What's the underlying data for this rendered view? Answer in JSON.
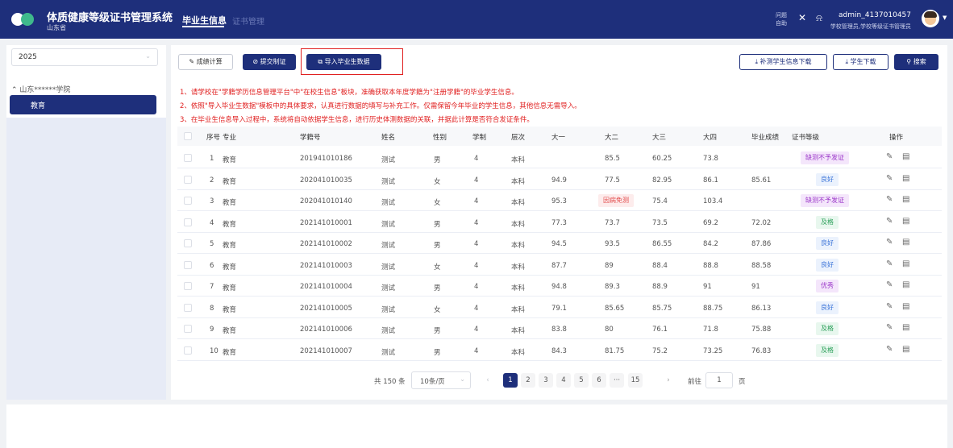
{
  "header": {
    "system_title": "体质健康等级证书管理系统",
    "province": "山东省",
    "nav_active": "毕业生信息",
    "nav_other": "证书管理",
    "help_label": "问题自助",
    "user_name": "admin_4137010457",
    "user_role": "学校管理员,学校等级证书管理员"
  },
  "sidebar": {
    "year": "2025",
    "tree_root": "山东******学院",
    "tree_node": "教育"
  },
  "toolbar": {
    "calc_label": "成绩计算",
    "submit_label": "提交制证",
    "import_label": "导入毕业生数据",
    "supplement_label": "补测学生信息下载",
    "student_download_label": "学生下载",
    "search_label": "搜索"
  },
  "notices": [
    "1、请学校在\"学籍学历信息管理平台\"中\"在校生信息\"板块，准确获取本年度学籍为\"注册学籍\"的毕业学生信息。",
    "2、依照\"导入毕业生数据\"模板中的具体要求，认真进行数据的填写与补充工作。仅需保留今年毕业的学生信息，其他信息无需导入。",
    "3、在毕业生信息导入过程中，系统将自动依据学生信息，进行历史体测数据的关联，并据此计算是否符合发证条件。"
  ],
  "table": {
    "columns": [
      "序号",
      "专业",
      "学籍号",
      "姓名",
      "性别",
      "学制",
      "层次",
      "大一",
      "大二",
      "大三",
      "大四",
      "毕业成绩",
      "证书等级",
      "操作"
    ],
    "rows": [
      {
        "no": "1",
        "major": "教育",
        "id": "201941010186",
        "name": "测试",
        "gender": "男",
        "years": "4",
        "level": "本科",
        "y1": "",
        "y2": "85.5",
        "y2_flag": "",
        "y3": "60.25",
        "y4": "73.8",
        "grad": "",
        "cert": "缺测不予发证",
        "cert_type": "purple"
      },
      {
        "no": "2",
        "major": "教育",
        "id": "202041010035",
        "name": "测试",
        "gender": "女",
        "years": "4",
        "level": "本科",
        "y1": "94.9",
        "y2": "77.5",
        "y2_flag": "",
        "y3": "82.95",
        "y4": "86.1",
        "grad": "85.61",
        "cert": "良好",
        "cert_type": "blue"
      },
      {
        "no": "3",
        "major": "教育",
        "id": "202041010140",
        "name": "测试",
        "gender": "女",
        "years": "4",
        "level": "本科",
        "y1": "95.3",
        "y2": "",
        "y2_flag": "因病免测",
        "y3": "75.4",
        "y4": "103.4",
        "grad": "",
        "cert": "缺测不予发证",
        "cert_type": "purple"
      },
      {
        "no": "4",
        "major": "教育",
        "id": "202141010001",
        "name": "测试",
        "gender": "男",
        "years": "4",
        "level": "本科",
        "y1": "77.3",
        "y2": "73.7",
        "y2_flag": "",
        "y3": "73.5",
        "y4": "69.2",
        "grad": "72.02",
        "cert": "及格",
        "cert_type": "green"
      },
      {
        "no": "5",
        "major": "教育",
        "id": "202141010002",
        "name": "测试",
        "gender": "男",
        "years": "4",
        "level": "本科",
        "y1": "94.5",
        "y2": "93.5",
        "y2_flag": "",
        "y3": "86.55",
        "y4": "84.2",
        "grad": "87.86",
        "cert": "良好",
        "cert_type": "blue"
      },
      {
        "no": "6",
        "major": "教育",
        "id": "202141010003",
        "name": "测试",
        "gender": "女",
        "years": "4",
        "level": "本科",
        "y1": "87.7",
        "y2": "89",
        "y2_flag": "",
        "y3": "88.4",
        "y4": "88.8",
        "grad": "88.58",
        "cert": "良好",
        "cert_type": "blue"
      },
      {
        "no": "7",
        "major": "教育",
        "id": "202141010004",
        "name": "测试",
        "gender": "男",
        "years": "4",
        "level": "本科",
        "y1": "94.8",
        "y2": "89.3",
        "y2_flag": "",
        "y3": "88.9",
        "y4": "91",
        "grad": "91",
        "cert": "优秀",
        "cert_type": "purple"
      },
      {
        "no": "8",
        "major": "教育",
        "id": "202141010005",
        "name": "测试",
        "gender": "女",
        "years": "4",
        "level": "本科",
        "y1": "79.1",
        "y2": "85.65",
        "y2_flag": "",
        "y3": "85.75",
        "y4": "88.75",
        "grad": "86.13",
        "cert": "良好",
        "cert_type": "blue"
      },
      {
        "no": "9",
        "major": "教育",
        "id": "202141010006",
        "name": "测试",
        "gender": "男",
        "years": "4",
        "level": "本科",
        "y1": "83.8",
        "y2": "80",
        "y2_flag": "",
        "y3": "76.1",
        "y4": "71.8",
        "grad": "75.88",
        "cert": "及格",
        "cert_type": "green"
      },
      {
        "no": "10",
        "major": "教育",
        "id": "202141010007",
        "name": "测试",
        "gender": "男",
        "years": "4",
        "level": "本科",
        "y1": "84.3",
        "y2": "81.75",
        "y2_flag": "",
        "y3": "75.2",
        "y4": "73.25",
        "grad": "76.83",
        "cert": "及格",
        "cert_type": "green"
      }
    ]
  },
  "pagination": {
    "total": "共 150 条",
    "page_size": "10条/页",
    "pages": [
      "1",
      "2",
      "3",
      "4",
      "5",
      "6",
      "···",
      "15"
    ],
    "current": "1",
    "goto_label": "前往",
    "goto_value": "1",
    "goto_unit": "页"
  }
}
